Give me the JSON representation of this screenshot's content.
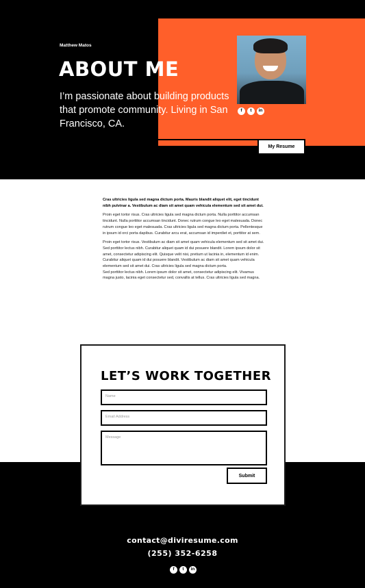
{
  "hero": {
    "name": "Matthew Matos",
    "title": "ABOUT ME",
    "tagline": "I’m passionate about building products that promote community. Living in San Francisco, CA.",
    "resume_button": "My Resume",
    "accent_color": "#ff5f2a",
    "social": [
      {
        "icon": "facebook-icon",
        "glyph": "f"
      },
      {
        "icon": "twitter-icon",
        "glyph": "t"
      },
      {
        "icon": "linkedin-icon",
        "glyph": "in"
      }
    ]
  },
  "article": {
    "lead": "Cras ultricies ligula sed magna dictum porta. Mauris blandit aliquet elit, eget tincidunt nibh pulvinar a. Vestibulum ac diam sit amet quam vehicula elementum sed sit amet dui.",
    "paragraph_1": "Proin eget tortor risus. Cras ultricies ligula sed magna dictum porta. Nulla porttitor accumsan tincidunt. Nulla porttitor accumsan tincidunt. Donec rutrum congue leo eget malesuada. Donec rutrum congue leo eget malesuada. Cras ultricies ligula sed magna dictum porta. Pellentesque in ipsum id orci porta dapibus. Curabitur arcu erat, accumsan id imperdiet et, porttitor at sem.",
    "paragraph_2": "Proin eget tortor risus. Vestibulum ac diam sit amet quam vehicula elementum sed sit amet dui. Sed porttitor lectus nibh. Curabitur aliquet quam id dui posuere blandit. Lorem ipsum dolor sit amet, consectetur adipiscing elit. Quisque velit nisi, pretium ut lacinia in, elementum id enim. Curabitur aliquet quam id dui posuere blandit. Vestibulum ac diam sit amet quam vehicula elementum sed sit amet dui. Cras ultricies ligula sed magna dictum porta.",
    "paragraph_3": "Sed porttitor lectus nibh. Lorem ipsum dolor sit amet, consectetur adipiscing elit. Vivamus magna justo, lacinia eget consectetur sed, convallis at tellus. Cras ultricies ligula sed magna."
  },
  "contact": {
    "title": "LET’S WORK TOGETHER",
    "name_placeholder": "Name",
    "email_placeholder": "Email Address",
    "message_placeholder": "Message",
    "submit_label": "Submit"
  },
  "footer": {
    "email": "contact@diviresume.com",
    "phone": "(255) 352-6258",
    "social": [
      {
        "icon": "facebook-icon",
        "glyph": "f"
      },
      {
        "icon": "twitter-icon",
        "glyph": "t"
      },
      {
        "icon": "linkedin-icon",
        "glyph": "in"
      }
    ]
  }
}
